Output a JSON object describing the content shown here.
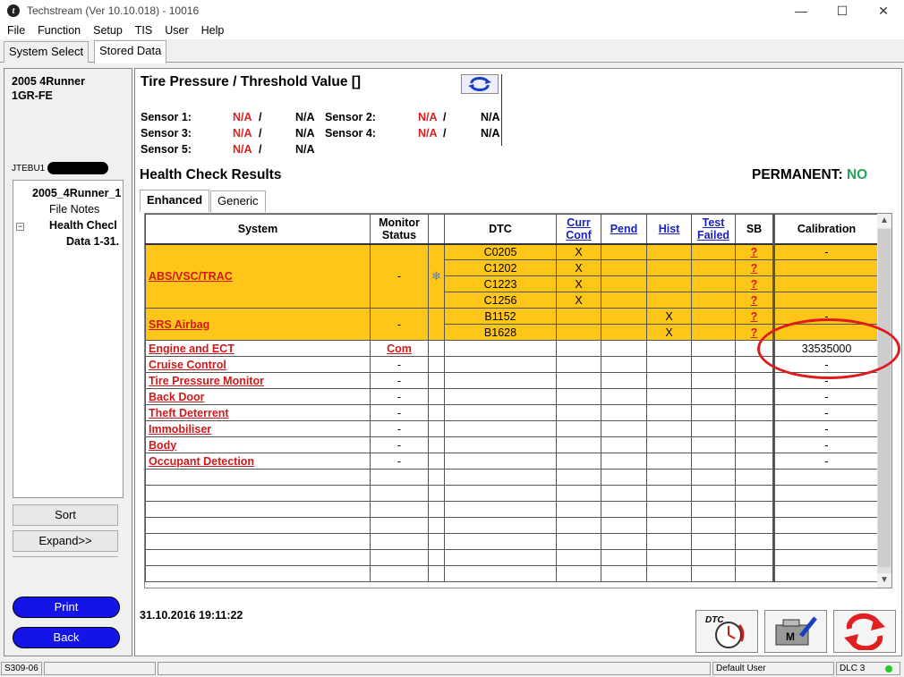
{
  "window": {
    "title": "Techstream (Ver 10.10.018) - 10016",
    "logo_letter": "t"
  },
  "menu": [
    "File",
    "Function",
    "Setup",
    "TIS",
    "User",
    "Help"
  ],
  "top_tabs": [
    "System Select",
    "Stored Data"
  ],
  "vehicle": {
    "model": "2005 4Runner",
    "engine": "1GR-FE",
    "vin_prefix": "JTEBU1"
  },
  "tree": {
    "root": "2005_4Runner_1",
    "file_notes": "File Notes",
    "health_check": "Health Checl",
    "data": "Data 1-31.",
    "expander": "−"
  },
  "buttons": {
    "sort": "Sort",
    "expand": "Expand>>",
    "print": "Print",
    "back": "Back"
  },
  "tire": {
    "title": "Tire Pressure / Threshold Value []",
    "sensors": [
      {
        "label": "Sensor 1:",
        "v1": "N/A",
        "sep": "/",
        "v2": "N/A"
      },
      {
        "label": "Sensor 2:",
        "v1": "N/A",
        "sep": "/",
        "v2": "N/A"
      },
      {
        "label": "Sensor 3:",
        "v1": "N/A",
        "sep": "/",
        "v2": "N/A"
      },
      {
        "label": "Sensor 4:",
        "v1": "N/A",
        "sep": "/",
        "v2": "N/A"
      },
      {
        "label": "Sensor 5:",
        "v1": "N/A",
        "sep": "/",
        "v2": "N/A"
      }
    ]
  },
  "health": {
    "title": "Health Check Results",
    "permanent_label": "PERMANENT:",
    "permanent_value": "NO"
  },
  "subtabs": [
    "Enhanced",
    "Generic"
  ],
  "table": {
    "headers": {
      "system": "System",
      "monitor1": "Monitor",
      "monitor2": "Status",
      "dtc": "DTC",
      "curr1": "Curr",
      "curr2": "Conf",
      "pend": "Pend",
      "hist": "Hist",
      "test1": "Test",
      "test2": "Failed",
      "sb": "SB",
      "calibration": "Calibration"
    },
    "groups": [
      {
        "system": "ABS/VSC/TRAC",
        "monitor": "-",
        "rows": [
          {
            "dtc": "C0205",
            "curr": "X",
            "hist": "",
            "sb": "?",
            "cal": "-"
          },
          {
            "dtc": "C1202",
            "curr": "X",
            "hist": "",
            "sb": "?",
            "cal": ""
          },
          {
            "dtc": "C1223",
            "curr": "X",
            "hist": "",
            "sb": "?",
            "cal": ""
          },
          {
            "dtc": "C1256",
            "curr": "X",
            "hist": "",
            "sb": "?",
            "cal": ""
          }
        ]
      },
      {
        "system": "SRS Airbag",
        "monitor": "-",
        "rows": [
          {
            "dtc": "B1152",
            "curr": "",
            "hist": "X",
            "sb": "?",
            "cal": "-"
          },
          {
            "dtc": "B1628",
            "curr": "",
            "hist": "X",
            "sb": "?",
            "cal": ""
          }
        ]
      }
    ],
    "systems": [
      {
        "system": "Engine and ECT",
        "monitor": "Com",
        "cal": "33535000"
      },
      {
        "system": "Cruise Control",
        "monitor": "-",
        "cal": "-"
      },
      {
        "system": "Tire Pressure Monitor",
        "monitor": "-",
        "cal": "-"
      },
      {
        "system": "Back Door",
        "monitor": "-",
        "cal": "-"
      },
      {
        "system": "Theft Deterrent",
        "monitor": "-",
        "cal": "-"
      },
      {
        "system": "Immobiliser",
        "monitor": "-",
        "cal": "-"
      },
      {
        "system": "Body",
        "monitor": "-",
        "cal": "-"
      },
      {
        "system": "Occupant Detection",
        "monitor": "-",
        "cal": "-"
      }
    ],
    "empty_rows": 7
  },
  "datetime": "31.10.2016 19:11:22",
  "icons": {
    "dtc_label": "DTC",
    "m_label": "M"
  },
  "status": {
    "code": "S309-06",
    "user": "Default User",
    "dlc": "DLC 3",
    "dlc_color": "#22cc22"
  }
}
